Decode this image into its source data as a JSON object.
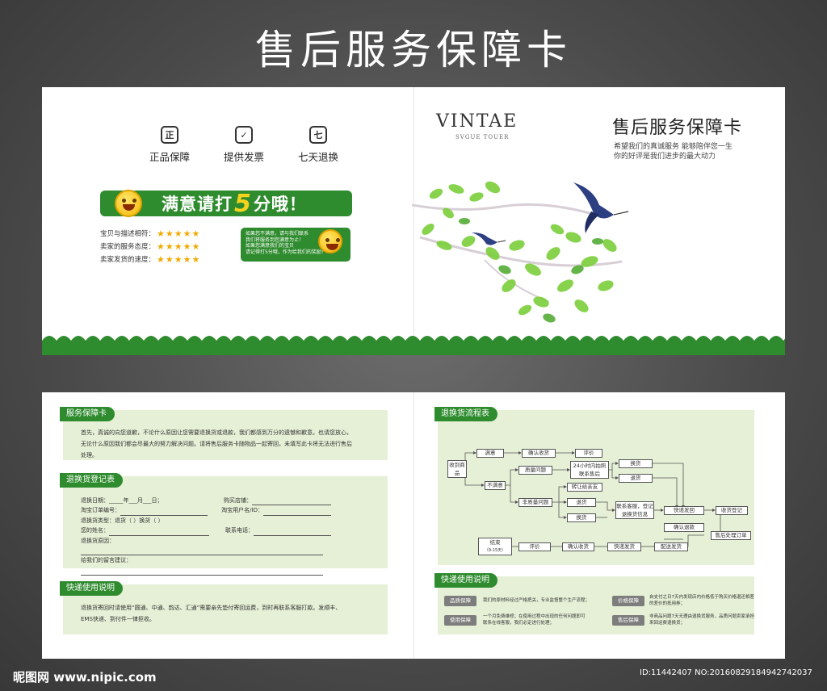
{
  "title": "售后服务保障卡",
  "top_left": {
    "icons": [
      {
        "glyph": "正",
        "label": "正品保障",
        "icon": "authentic-icon"
      },
      {
        "glyph": "✓",
        "label": "提供发票",
        "icon": "invoice-icon"
      },
      {
        "glyph": "七",
        "label": "七天退换",
        "icon": "seven-day-return-icon"
      }
    ],
    "banner_pre": "满意请打",
    "banner_num": "5",
    "banner_post": "分哦！",
    "ratings": [
      {
        "label": "宝贝与描述相符：",
        "stars": "★★★★★"
      },
      {
        "label": "卖家的服务态度：",
        "stars": "★★★★★"
      },
      {
        "label": "卖家发货的速度：",
        "stars": "★★★★★"
      }
    ],
    "tip_lines": [
      "如果您不满意，请与我们联系",
      "我们将服务到您满意为止！",
      "如果您满意我们的宝贝",
      "请记得打5分哦，作为给我们的奖励！"
    ]
  },
  "top_right": {
    "brand": "VINTAE",
    "brand_sub": "SVGUE TOUER",
    "title": "售后服务保障卡",
    "sub1": "希望我们的真诚服务  能够陪伴您一生",
    "sub2": "你的好评是我们进步的最大动力"
  },
  "service": {
    "tag": "服务保障卡",
    "text1": "首先，真诚的向您道歉，不论什么原因让您需要退换货或退款，我们都感到万分的遗憾和歉意。也请您放心，",
    "text2": "无论什么原因我们都会尽最大的努力解决问题。请将售后服务卡随物品一起寄回，未填写此卡将无法进行售后",
    "text3": "处理。"
  },
  "register": {
    "tag": "退换货登记表",
    "f_date": "退换日期：_____年___月___日；",
    "f_shop": "购买店铺：",
    "f_order": "淘宝订单编号：",
    "f_user": "淘宝用户名/ID：",
    "f_type": "退换货类型：退货（  ）换货（  ）",
    "f_name": "您的姓名：",
    "f_phone": "联系电话：",
    "f_reason": "退换货原因：",
    "f_msg": "给我们的留言建议："
  },
  "express": {
    "tag": "快递使用说明",
    "text1": "退换货寄回时请使用“圆通、中通、韵达、汇通”需要亲先垫付寄回运费，到时再联系客服打款。发顺丰、",
    "text2": "EMS快递、到付件一律拒收。"
  },
  "flow": {
    "tag": "退换货流程表",
    "n_receive": "收到商品",
    "n_satisfied": "满意",
    "n_confirm1": "确认收货",
    "n_review1": "评价",
    "n_unsatisfied": "不满意",
    "n_quality": "质量问题",
    "n_24h": "24小时内拍照联系售后",
    "n_exchange1": "换货",
    "n_return1": "退货",
    "n_friend": "转让给亲友",
    "n_nonquality": "非质量问题",
    "n_return2": "退货",
    "n_exchange2": "换货",
    "n_cs": "联系客服，登记退换货信息",
    "n_ship_back": "快递发回",
    "n_receipt": "收货登记",
    "n_refund": "确认退款",
    "n_process": "售后处理订单",
    "n_end": "结束",
    "n_end_sub": "（9-15天）",
    "n_review2": "评价",
    "n_confirm2": "确认收货",
    "n_send": "快递发货",
    "n_deliver": "配送发货"
  },
  "express2": {
    "tag": "快递使用说明",
    "items": [
      {
        "tag": "品质保障",
        "text1": "我们的原材料经过严格把关，专业监督整个生产流程；",
        "text2": ""
      },
      {
        "tag": "使用保障",
        "text1": "一个月免费维修；在使用过程中出现的任何问题即可",
        "text2": "联系在线客服，我们必定进行处理；"
      },
      {
        "tag": "价格保障",
        "text1": "自支付之日7天内发现店内价格低于购买价格退还相差",
        "text2": "的差价的抵用券；"
      },
      {
        "tag": "售后保障",
        "text1": "非商品问题7天无理由退换货服务，品质问题卖家承担",
        "text2": "来回运费退换货；"
      }
    ]
  },
  "watermark": {
    "logo": "昵图网 www.nipic.com",
    "id": "ID:11442407 NO:20160829184942742037"
  }
}
